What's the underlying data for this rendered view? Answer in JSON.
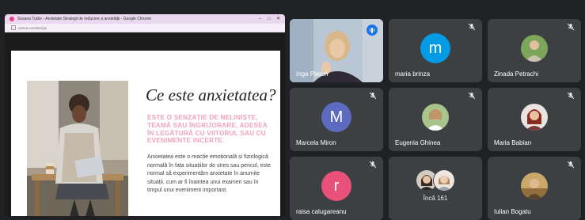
{
  "presentation": {
    "window_title": "Susana Tudor - Anxietate Strategii de reducere a anxietății - Google Chrome",
    "url": "canva.com/design",
    "window_controls": {
      "minimize": "–",
      "maximize": "□",
      "close": "✕"
    },
    "slide": {
      "heading": "Ce este anxietatea?",
      "subheading": "ESTE O SENZAȚIE DE NELINIȘTE, TEAMĂ SAU ÎNGRIJORARE, ADESEA ÎN LEGĂTURĂ CU VIITORUL SAU CU EVENIMENTE INCERTE.",
      "body": "Anxietatea este o reacție emoțională și fiziologică normală în fața situațiilor de stres sau pericol, este normal să experimentăm anxietate în anumite situații, cum ar fi înaintea unui examen sau în timpul unui eveniment important."
    }
  },
  "participants": [
    {
      "name": "Inga Platon",
      "kind": "video",
      "speaking": true
    },
    {
      "name": "maria brinza",
      "kind": "initial",
      "initial": "m",
      "color": "#039be5",
      "muted": true
    },
    {
      "name": "Zinada Petrachi",
      "kind": "photo",
      "muted": true
    },
    {
      "name": "Marcela Miron",
      "kind": "initial",
      "initial": "M",
      "color": "#5c6bc0",
      "muted": true
    },
    {
      "name": "Eugenia Ghinea",
      "kind": "photo",
      "muted": true
    },
    {
      "name": "Maria Babian",
      "kind": "photo",
      "muted": true
    },
    {
      "name": "raisa calugareanu",
      "kind": "initial",
      "initial": "r",
      "color": "#e8527a",
      "muted": true
    },
    {
      "name": "Încă 161",
      "kind": "overflow"
    },
    {
      "name": "Iulian Bogatu",
      "kind": "photo",
      "muted": true
    }
  ],
  "icons": {
    "mute": "mic-off-icon",
    "speaking": "audio-level-icon"
  }
}
